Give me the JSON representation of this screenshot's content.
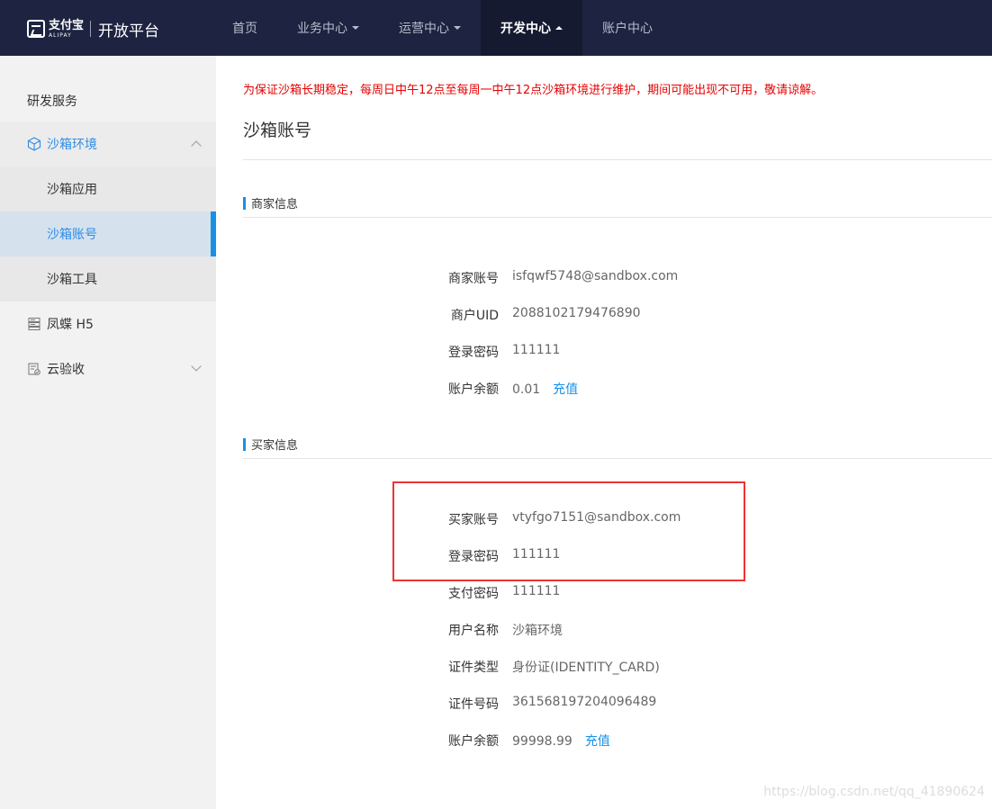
{
  "header": {
    "logo_cn": "支付宝",
    "logo_en": "ALIPAY",
    "site_title": "开放平台",
    "nav": [
      {
        "label": "首页",
        "has_caret": false,
        "active": false
      },
      {
        "label": "业务中心",
        "has_caret": true,
        "active": false
      },
      {
        "label": "运营中心",
        "has_caret": true,
        "active": false
      },
      {
        "label": "开发中心",
        "has_caret": true,
        "active": true
      },
      {
        "label": "账户中心",
        "has_caret": false,
        "active": false
      }
    ]
  },
  "sidebar": {
    "heading": "研发服务",
    "groups": [
      {
        "label": "沙箱环境",
        "icon": "cube-icon",
        "expanded": true,
        "children": [
          {
            "label": "沙箱应用",
            "active": false
          },
          {
            "label": "沙箱账号",
            "active": true
          },
          {
            "label": "沙箱工具",
            "active": false
          }
        ]
      },
      {
        "label": "凤蝶 H5",
        "icon": "server-icon"
      },
      {
        "label": "云验收",
        "icon": "checklist-icon",
        "expanded": false
      }
    ]
  },
  "main": {
    "notice": "为保证沙箱长期稳定，每周日中午12点至每周一中午12点沙箱环境进行维护，期间可能出现不可用，敬请谅解。",
    "title": "沙箱账号",
    "merchant": {
      "heading": "商家信息",
      "account_label": "商家账号",
      "account_value": "isfqwf5748@sandbox.com",
      "uid_label": "商户UID",
      "uid_value": "2088102179476890",
      "password_label": "登录密码",
      "password_value": "111111",
      "balance_label": "账户余额",
      "balance_value": "0.01",
      "recharge": "充值"
    },
    "buyer": {
      "heading": "买家信息",
      "account_label": "买家账号",
      "account_value": "vtyfgo7151@sandbox.com",
      "password_label": "登录密码",
      "password_value": "111111",
      "pay_password_label": "支付密码",
      "pay_password_value": "111111",
      "username_label": "用户名称",
      "username_value": "沙箱环境",
      "id_type_label": "证件类型",
      "id_type_value": "身份证(IDENTITY_CARD)",
      "id_number_label": "证件号码",
      "id_number_value": "361568197204096489",
      "balance_label": "账户余额",
      "balance_value": "99998.99",
      "recharge": "充值"
    }
  },
  "watermark": "https://blog.csdn.net/qq_41890624",
  "colors": {
    "accent": "#1890e6",
    "header_bg": "#1d2340",
    "notice": "#e60000",
    "highlight": "#ee3333"
  }
}
